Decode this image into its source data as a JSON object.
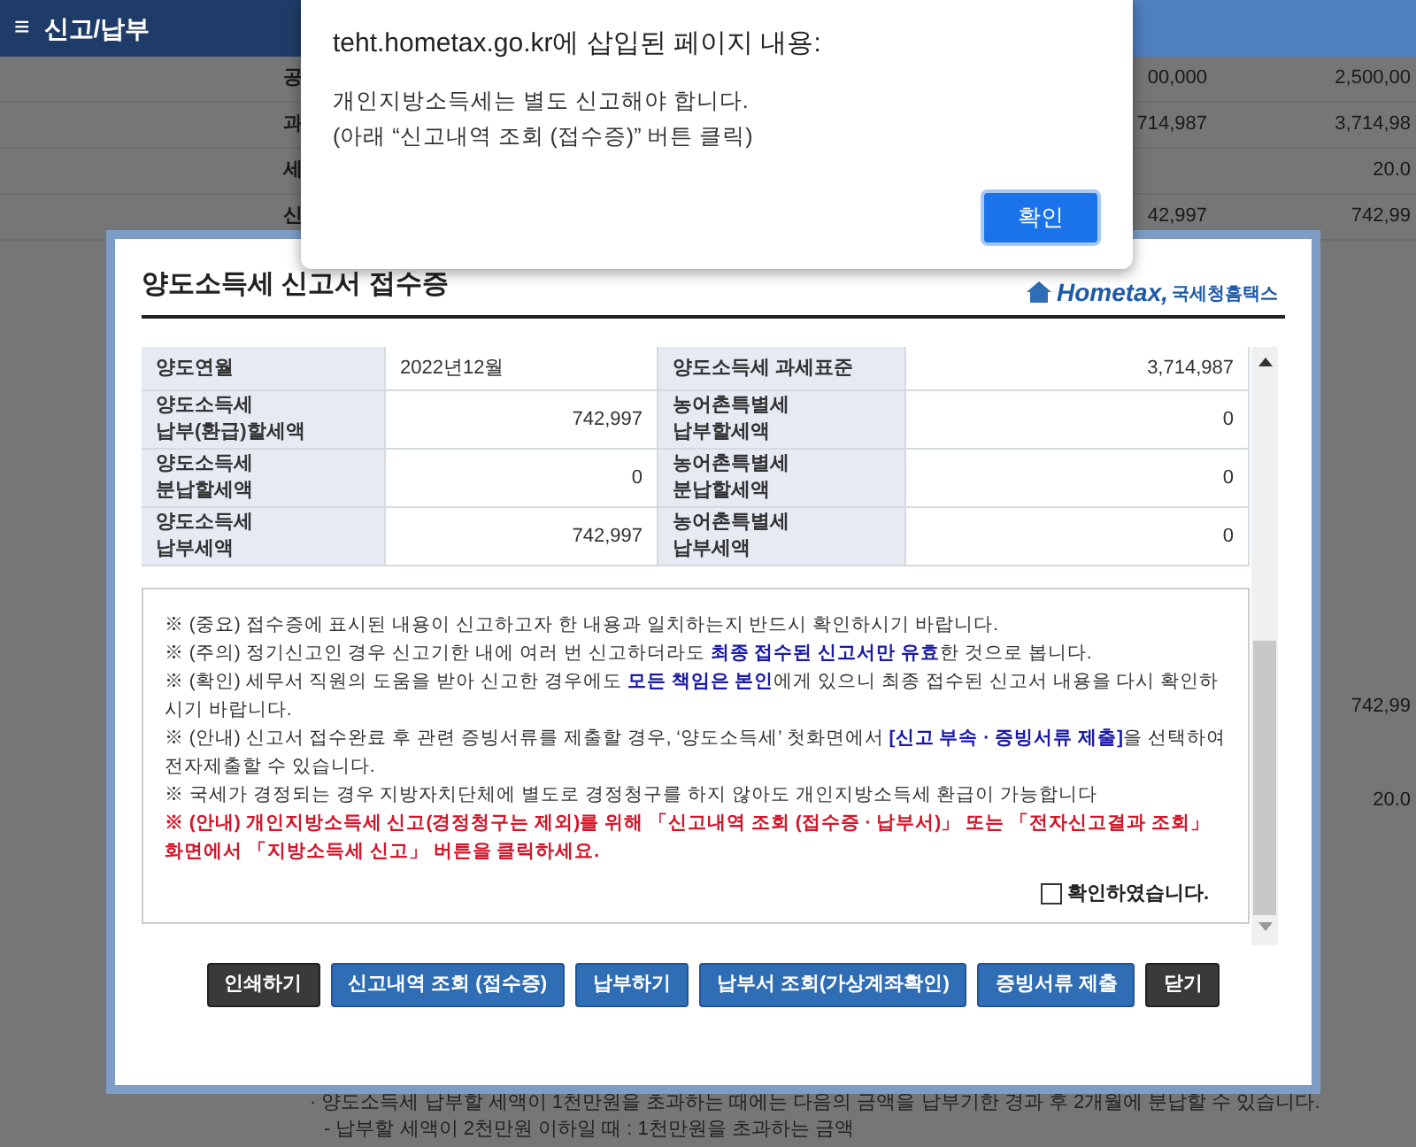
{
  "header": {
    "menu_icon": "≡",
    "title": "신고/납부"
  },
  "background_rows": [
    {
      "label": "공",
      "value": "00,000",
      "total": "2,500,00"
    },
    {
      "label": "과",
      "value": "714,987",
      "total": "3,714,98"
    },
    {
      "label": "세",
      "value": "",
      "total": "20.0"
    },
    {
      "label": "신",
      "value": "42,997",
      "total": "742,99"
    }
  ],
  "background_totals": [
    "742,99",
    "20.0"
  ],
  "background_notes": [
    "· 양도소득세 납부할 세액이 1천만원을 초과하는 때에는 다음의 금액을 납부기한 경과 후 2개월에 분납할 수 있습니다.",
    "- 납부할 세액이 2천만원 이하일 때 : 1천만원을 초과하는 금액"
  ],
  "modal": {
    "title": "양도소득세 신고서 접수증",
    "logo": {
      "wordmark": "Hometax,",
      "name": "국세청홈택스"
    },
    "table": [
      [
        {
          "label": "양도연월",
          "value": "2022년12월"
        },
        {
          "label": "양도소득세 과세표준",
          "value": "3,714,987"
        }
      ],
      [
        {
          "label": "양도소득세\n납부(환급)할세액",
          "value": "742,997"
        },
        {
          "label": "농어촌특별세\n납부할세액",
          "value": "0"
        }
      ],
      [
        {
          "label": "양도소득세\n분납할세액",
          "value": "0"
        },
        {
          "label": "농어촌특별세\n분납할세액",
          "value": "0"
        }
      ],
      [
        {
          "label": "양도소득세\n납부세액",
          "value": "742,997"
        },
        {
          "label": "농어촌특별세\n납부세액",
          "value": "0"
        }
      ]
    ],
    "notices": [
      {
        "kind": "normal",
        "text": "※ (중요) 접수증에 표시된 내용이 신고하고자 한 내용과 일치하는지 반드시 확인하시기 바랍니다."
      },
      {
        "kind": "normal",
        "text": "※ (주의) 정기신고인 경우 신고기한 내에 여러 번 신고하더라도 **최종 접수된 신고서만 유효**한 것으로 봅니다."
      },
      {
        "kind": "normal",
        "text": "※ (확인) 세무서 직원의 도움을 받아 신고한 경우에도 **모든 책임은 본인**에게 있으니 최종 접수된 신고서 내용을 다시 확인하시기 바랍니다."
      },
      {
        "kind": "normal",
        "text": "※ (안내) 신고서 접수완료 후 관련 증빙서류를 제출할 경우, ‘양도소득세’ 첫화면에서 **[신고 부속 · 증빙서류 제출]**을 선택하여 전자제출할 수 있습니다."
      },
      {
        "kind": "normal",
        "text": "※ 국세가 경정되는 경우 지방자치단체에 별도로 경정청구를 하지 않아도 개인지방소득세 환급이 가능합니다"
      },
      {
        "kind": "warning",
        "text": "※ (안내) 개인지방소득세 신고(경정청구는 제외)를 위해 「신고내역 조회 (접수증 · 납부서)」 또는 「전자신고결과 조회」 화면에서 「지방소득세 신고」 버튼을 클릭하세요."
      }
    ],
    "confirm": {
      "label": "확인하였습니다.",
      "checked": false
    },
    "buttons": [
      {
        "label": "인쇄하기",
        "kind": "dark"
      },
      {
        "label": "신고내역 조회 (접수증)",
        "kind": "primary"
      },
      {
        "label": "납부하기",
        "kind": "primary"
      },
      {
        "label": "납부서 조회(가상계좌확인)",
        "kind": "primary"
      },
      {
        "label": "증빙서류 제출",
        "kind": "primary"
      },
      {
        "label": "닫기",
        "kind": "dark"
      }
    ]
  },
  "alert": {
    "title": "teht.hometax.go.kr에 삽입된 페이지 내용:",
    "lines": [
      "개인지방소득세는 별도 신고해야 합니다.",
      "(아래 “신고내역 조회 (접수증)” 버튼 클릭)"
    ],
    "button": "확인"
  }
}
